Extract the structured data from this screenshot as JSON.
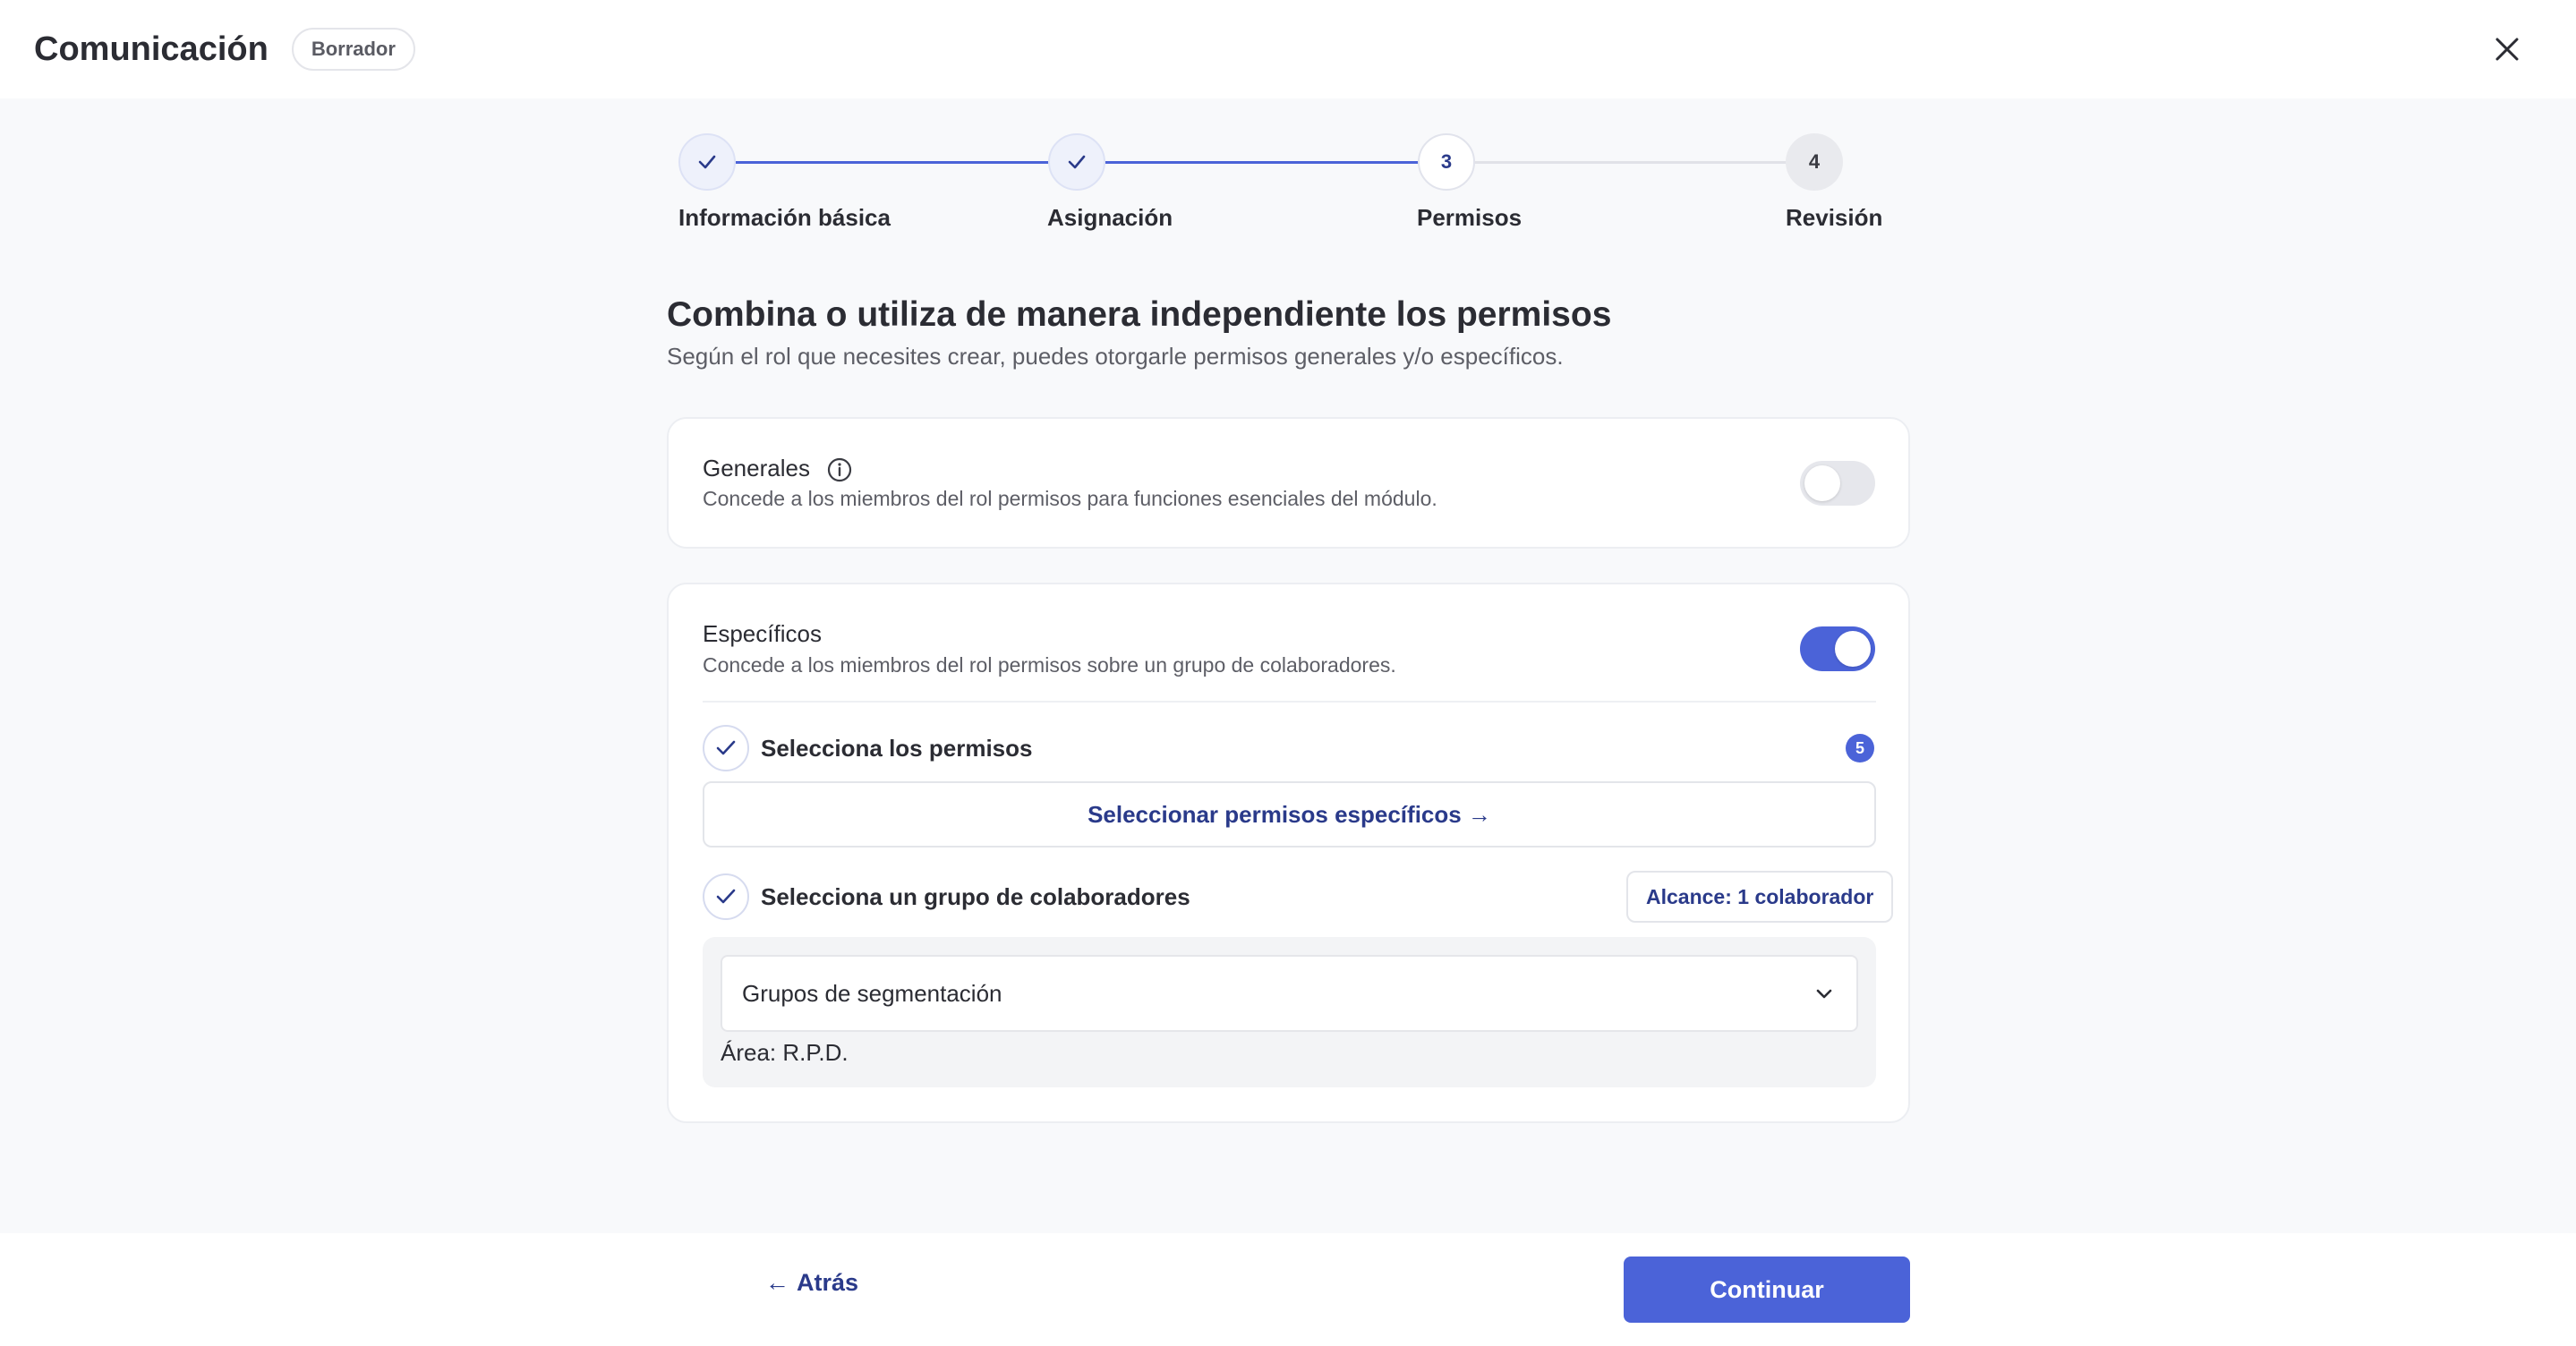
{
  "header": {
    "title": "Comunicación",
    "status_badge": "Borrador"
  },
  "stepper": {
    "steps": [
      {
        "number": "1",
        "label": "Información básica",
        "state": "done"
      },
      {
        "number": "2",
        "label": "Asignación",
        "state": "done"
      },
      {
        "number": "3",
        "label": "Permisos",
        "state": "current"
      },
      {
        "number": "4",
        "label": "Revisión",
        "state": "pending"
      }
    ]
  },
  "main": {
    "heading": "Combina o utiliza de manera independiente los permisos",
    "subheading": "Según el rol que necesites crear, puedes otorgarle permisos generales y/o específicos."
  },
  "general": {
    "title": "Generales",
    "description": "Concede a los miembros del rol permisos para funciones esenciales del módulo.",
    "enabled": false
  },
  "specific": {
    "title": "Específicos",
    "description": "Concede a los miembros del rol permisos sobre un grupo de colaboradores.",
    "enabled": true,
    "permissions": {
      "label": "Selecciona los permisos",
      "count": "5",
      "button_label": "Seleccionar permisos específicos →"
    },
    "group": {
      "label": "Selecciona un grupo de colaboradores",
      "scope": "Alcance: 1 colaborador",
      "select_value": "Grupos de segmentación",
      "area": "Área: R.P.D."
    }
  },
  "footer": {
    "back_label": "Atrás",
    "back_arrow": "←",
    "continue_label": "Continuar"
  },
  "colors": {
    "accent": "#4b63d8",
    "link": "#2a3a8a",
    "toggle_off": "#e6e7ec",
    "background": "#f8f9fb"
  },
  "icons": [
    "close-icon",
    "check-icon",
    "info-icon",
    "chevron-down-icon",
    "arrow-left-icon"
  ]
}
